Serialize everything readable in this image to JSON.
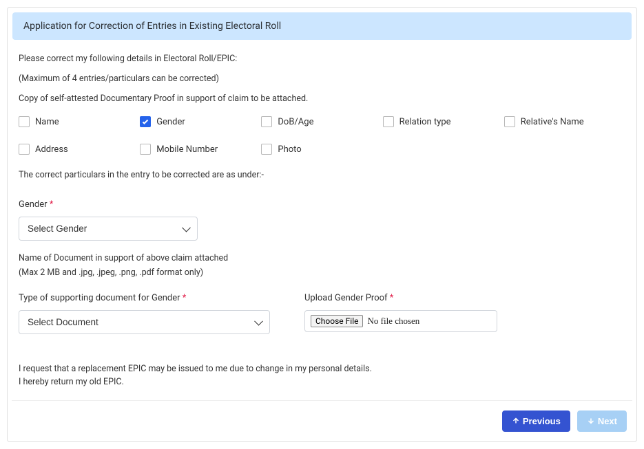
{
  "header": {
    "title": "Application for Correction of Entries in Existing Electoral Roll"
  },
  "intro": {
    "line1": "Please correct my following details in Electoral Roll/EPIC:",
    "line2": "(Maximum of 4 entries/particulars can be corrected)",
    "line3": "Copy of self-attested Documentary Proof in support of claim to be attached."
  },
  "checkboxes": [
    {
      "label": "Name",
      "checked": false
    },
    {
      "label": "Gender",
      "checked": true
    },
    {
      "label": "DoB/Age",
      "checked": false
    },
    {
      "label": "Relation type",
      "checked": false
    },
    {
      "label": "Relative's Name",
      "checked": false
    },
    {
      "label": "Address",
      "checked": false
    },
    {
      "label": "Mobile Number",
      "checked": false
    },
    {
      "label": "Photo",
      "checked": false
    }
  ],
  "section_under": "The correct particulars in the entry to be corrected are as under:-",
  "gender_field": {
    "label": "Gender",
    "placeholder": "Select Gender"
  },
  "doc_note": "Name of Document in support of above claim attached",
  "doc_sub": "(Max 2 MB and .jpg, .jpeg, .png, .pdf format only)",
  "doc_type": {
    "label": "Type of supporting document for Gender",
    "placeholder": "Select Document"
  },
  "upload": {
    "label": "Upload Gender Proof",
    "btn": "Choose File",
    "status": "No file chosen"
  },
  "declaration": {
    "line1": "I request that a replacement EPIC may be issued to me due to change in my personal details.",
    "line2": "I hereby return my old EPIC."
  },
  "buttons": {
    "prev": "Previous",
    "next": "Next"
  }
}
